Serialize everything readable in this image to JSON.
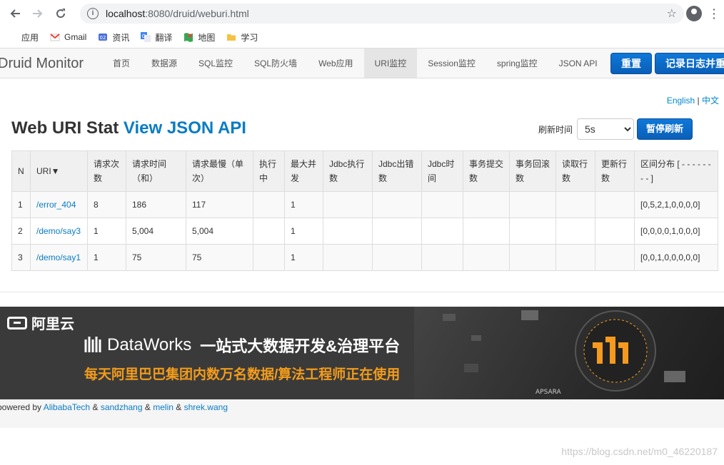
{
  "browser": {
    "url_host": "localhost",
    "url_rest": ":8080/druid/weburi.html",
    "bookmarks": [
      {
        "label": "应用",
        "icon": "apps-grid-icon"
      },
      {
        "label": "Gmail",
        "icon": "gmail-icon"
      },
      {
        "label": "资讯",
        "icon": "news-icon"
      },
      {
        "label": "翻译",
        "icon": "translate-icon"
      },
      {
        "label": "地图",
        "icon": "maps-icon"
      },
      {
        "label": "学习",
        "icon": "folder-icon"
      }
    ]
  },
  "navbar": {
    "brand": "Druid Monitor",
    "items": [
      {
        "label": "首页"
      },
      {
        "label": "数据源"
      },
      {
        "label": "SQL监控"
      },
      {
        "label": "SQL防火墙"
      },
      {
        "label": "Web应用"
      },
      {
        "label": "URI监控",
        "active": true
      },
      {
        "label": "Session监控"
      },
      {
        "label": "spring监控"
      },
      {
        "label": "JSON API"
      }
    ],
    "reset_label": "重置",
    "log_reset_label": "记录日志并重置"
  },
  "lang": {
    "english": "English",
    "sep": "|",
    "chinese": "中文"
  },
  "page": {
    "title": "Web URI Stat",
    "json_link": "View JSON API",
    "refresh_label": "刷新时间",
    "refresh_value": "5s",
    "pause_label": "暂停刷新"
  },
  "table": {
    "headers": [
      "N",
      "URI▼",
      "请求次数",
      "请求时间（和）",
      "请求最慢（单次）",
      "执行中",
      "最大并发",
      "Jdbc执行数",
      "Jdbc出错数",
      "Jdbc时间",
      "事务提交数",
      "事务回滚数",
      "读取行数",
      "更新行数",
      "区间分布 [ - - - - - - - - ]"
    ],
    "rows": [
      {
        "n": "1",
        "uri": "/error_404",
        "count": "8",
        "time": "186",
        "max": "117",
        "running": "",
        "concurrent": "1",
        "jdbc_exec": "",
        "jdbc_err": "",
        "jdbc_time": "",
        "tx_commit": "",
        "tx_rollback": "",
        "read": "",
        "update": "",
        "hist": "[0,5,2,1,0,0,0,0]"
      },
      {
        "n": "2",
        "uri": "/demo/say3",
        "count": "1",
        "time": "5,004",
        "max": "5,004",
        "running": "",
        "concurrent": "1",
        "jdbc_exec": "",
        "jdbc_err": "",
        "jdbc_time": "",
        "tx_commit": "",
        "tx_rollback": "",
        "read": "",
        "update": "",
        "hist": "[0,0,0,0,1,0,0,0]"
      },
      {
        "n": "3",
        "uri": "/demo/say1",
        "count": "1",
        "time": "75",
        "max": "75",
        "running": "",
        "concurrent": "1",
        "jdbc_exec": "",
        "jdbc_err": "",
        "jdbc_time": "",
        "tx_commit": "",
        "tx_rollback": "",
        "read": "",
        "update": "",
        "hist": "[0,0,1,0,0,0,0,0]"
      }
    ]
  },
  "banner": {
    "brand": "阿里云",
    "product": "DataWorks",
    "slogan": "一站式大数据开发&治理平台",
    "subtitle": "每天阿里巴巴集团内数万名数据/算法工程师正在使用"
  },
  "footer": {
    "prefix": "powered by",
    "links": [
      "AlibabaTech",
      "sandzhang",
      "melin",
      "shrek.wang"
    ],
    "amp": "&"
  },
  "watermark": "https://blog.csdn.net/m0_46220187",
  "colors": {
    "link": "#0a7cc4",
    "button": "#0e6ac8",
    "banner_orange": "#f39c1a"
  }
}
